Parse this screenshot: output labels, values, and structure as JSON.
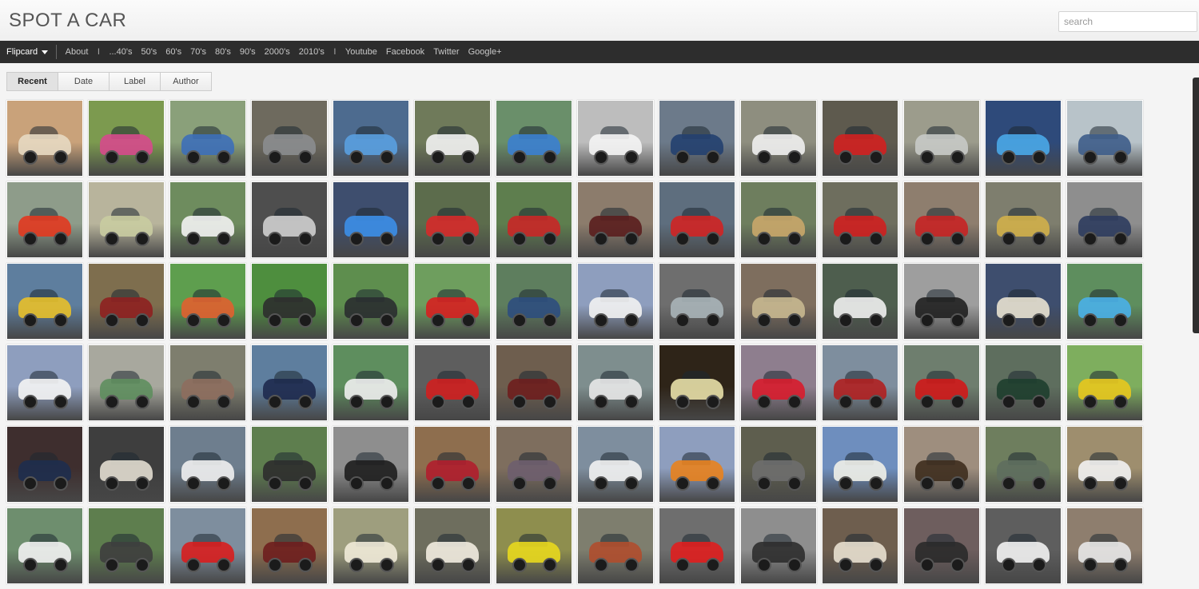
{
  "header": {
    "title": "SPOT A CAR",
    "search_placeholder": "search"
  },
  "nav": {
    "brand": "Flipcard",
    "items_a": [
      "About"
    ],
    "separator": "I",
    "items_b": [
      "...40's",
      "50's",
      "60's",
      "70's",
      "80's",
      "90's",
      "2000's",
      "2010's"
    ],
    "items_c": [
      "Youtube",
      "Facebook",
      "Twitter",
      "Google+"
    ]
  },
  "tabs": [
    {
      "label": "Recent",
      "active": true
    },
    {
      "label": "Date",
      "active": false
    },
    {
      "label": "Label",
      "active": false
    },
    {
      "label": "Author",
      "active": false
    }
  ],
  "grid": {
    "tiles": [
      {
        "bg": "#c9a27a",
        "car": "#e7d9c2"
      },
      {
        "bg": "#7c9a4f",
        "car": "#d64a8c"
      },
      {
        "bg": "#8aa07a",
        "car": "#3d6fb8"
      },
      {
        "bg": "#6e6a5e",
        "car": "#8b8d8f"
      },
      {
        "bg": "#4d6b8f",
        "car": "#5aa0e0"
      },
      {
        "bg": "#6f7a5a",
        "car": "#f2f2f2"
      },
      {
        "bg": "#6a8f6a",
        "car": "#3b7fd0"
      },
      {
        "bg": "#bdbdbd",
        "car": "#f4f4f4"
      },
      {
        "bg": "#6c7a8a",
        "car": "#23406f"
      },
      {
        "bg": "#8e8e7f",
        "car": "#f0f0f0"
      },
      {
        "bg": "#5e5a4e",
        "car": "#d12020"
      },
      {
        "bg": "#9c9c8c",
        "car": "#c8cac6"
      },
      {
        "bg": "#2e4a7a",
        "car": "#4aa8e8"
      },
      {
        "bg": "#b8c3c9",
        "car": "#3e5d8a"
      },
      {
        "bg": "#8e9c8a",
        "car": "#e2391f"
      },
      {
        "bg": "#b8b49c",
        "car": "#c9cca1"
      },
      {
        "bg": "#6e8c5e",
        "car": "#f2f2f2"
      },
      {
        "bg": "#4e4e4e",
        "car": "#cfcfcf"
      },
      {
        "bg": "#3e4e6e",
        "car": "#3c8fe8"
      },
      {
        "bg": "#5c6c4c",
        "car": "#d62a2a"
      },
      {
        "bg": "#5e7e4e",
        "car": "#c92727"
      },
      {
        "bg": "#8c7c6c",
        "car": "#5a1e1e"
      },
      {
        "bg": "#5e6e7e",
        "car": "#d02323"
      },
      {
        "bg": "#6e7e5e",
        "car": "#c9a76a"
      },
      {
        "bg": "#6e6e5e",
        "car": "#cf1f1f"
      },
      {
        "bg": "#8e7e6e",
        "car": "#c62323"
      },
      {
        "bg": "#7e7e6e",
        "car": "#d1b04a"
      },
      {
        "bg": "#8e8e8e",
        "car": "#2e3c5e"
      },
      {
        "bg": "#5e7e9e",
        "car": "#e8c02a"
      },
      {
        "bg": "#7e6e4e",
        "car": "#8e2020"
      },
      {
        "bg": "#5e9e4e",
        "car": "#e06030"
      },
      {
        "bg": "#4e8e3e",
        "car": "#2e2e2e"
      },
      {
        "bg": "#5e8e4e",
        "car": "#2a2e30"
      },
      {
        "bg": "#6e9e5e",
        "car": "#d62020"
      },
      {
        "bg": "#5e7e5e",
        "car": "#2e4e7e"
      },
      {
        "bg": "#8e9ebe",
        "car": "#f2f2f2"
      },
      {
        "bg": "#6e6e6e",
        "car": "#a8b4b8"
      },
      {
        "bg": "#7e6e5e",
        "car": "#c8b890"
      },
      {
        "bg": "#4e5e4e",
        "car": "#f0f0f0"
      },
      {
        "bg": "#9e9e9e",
        "car": "#202020"
      },
      {
        "bg": "#3e4e6e",
        "car": "#e8e2d0"
      },
      {
        "bg": "#5e8e5e",
        "car": "#4ab0e8"
      },
      {
        "bg": "#8e9ebe",
        "car": "#f4f4f4"
      },
      {
        "bg": "#a8a89e",
        "car": "#5e8e5e"
      },
      {
        "bg": "#7e7e6e",
        "car": "#8e6e5e"
      },
      {
        "bg": "#5e7e9e",
        "car": "#1e2a4e"
      },
      {
        "bg": "#5e8e5e",
        "car": "#eeeeee"
      },
      {
        "bg": "#5e5e5e",
        "car": "#d01f1f"
      },
      {
        "bg": "#6e5e4e",
        "car": "#6e1e1e"
      },
      {
        "bg": "#7e8e8e",
        "car": "#e8e8e8"
      },
      {
        "bg": "#2e2418",
        "car": "#e8e0a8"
      },
      {
        "bg": "#8e7e8e",
        "car": "#d81c2c"
      },
      {
        "bg": "#7e8e9e",
        "car": "#b02020"
      },
      {
        "bg": "#6e7e6e",
        "car": "#d01818"
      },
      {
        "bg": "#5e6e5e",
        "car": "#1e3e2e"
      },
      {
        "bg": "#7eae5e",
        "car": "#e8c81e"
      },
      {
        "bg": "#3e2e2e",
        "car": "#1e2e4e"
      },
      {
        "bg": "#3e3e3e",
        "car": "#e2ddd0"
      },
      {
        "bg": "#6e7e8e",
        "car": "#f0f0f0"
      },
      {
        "bg": "#5e7e4e",
        "car": "#2e2e2e"
      },
      {
        "bg": "#8e8e8e",
        "car": "#1e1e1e"
      },
      {
        "bg": "#8e6e4e",
        "car": "#b01e2e"
      },
      {
        "bg": "#7e6e5e",
        "car": "#6e5e6e"
      },
      {
        "bg": "#7e8e9e",
        "car": "#f2f2f2"
      },
      {
        "bg": "#8e9ebe",
        "car": "#e8821e"
      },
      {
        "bg": "#5e5e4e",
        "car": "#6e6e6e"
      },
      {
        "bg": "#6e8ebe",
        "car": "#f0f0e8"
      },
      {
        "bg": "#9e8e7e",
        "car": "#3e2e1e"
      },
      {
        "bg": "#6e7e5e",
        "car": "#5e6e5e"
      },
      {
        "bg": "#9e8e6e",
        "car": "#f2f2f2"
      },
      {
        "bg": "#6e8e6e",
        "car": "#f2f2f2"
      },
      {
        "bg": "#5e7e4e",
        "car": "#3e3e3e"
      },
      {
        "bg": "#7e8e9e",
        "car": "#d81e1e"
      },
      {
        "bg": "#8e6e4e",
        "car": "#6e1e1e"
      },
      {
        "bg": "#9e9e7e",
        "car": "#f0ead8"
      },
      {
        "bg": "#6e6e5e",
        "car": "#f2ece0"
      },
      {
        "bg": "#8e8e4e",
        "car": "#e8d81e"
      },
      {
        "bg": "#7e7e6e",
        "car": "#b04e2e"
      },
      {
        "bg": "#6e6e6e",
        "car": "#e01e1e"
      },
      {
        "bg": "#8e8e8e",
        "car": "#2e2e2e"
      },
      {
        "bg": "#6e5e4e",
        "car": "#e8e0d0"
      },
      {
        "bg": "#6e5e5e",
        "car": "#2a2a2a"
      },
      {
        "bg": "#5e5e5e",
        "car": "#f2f2f2"
      },
      {
        "bg": "#8e7e6e",
        "car": "#e8e8e8"
      }
    ]
  }
}
